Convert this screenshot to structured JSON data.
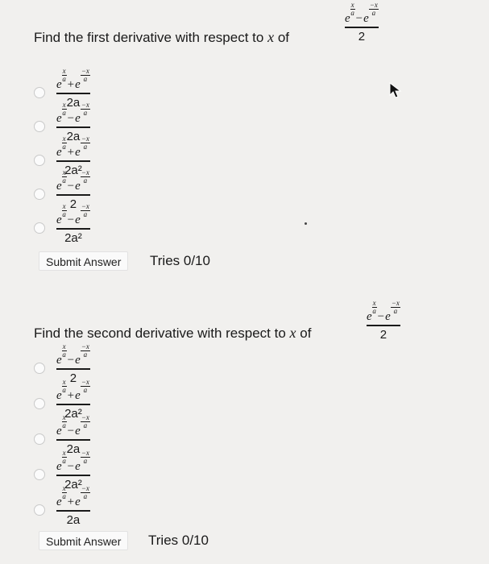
{
  "questions": [
    {
      "prompt_text": "Find the first derivative with respect to",
      "prompt_var": "x",
      "prompt_suffix": "of",
      "function": {
        "numerator": "e^(x/a) − e^(−x/a)",
        "denominator": "2"
      },
      "options": [
        {
          "op": "+",
          "denominator": "2a"
        },
        {
          "op": "−",
          "denominator": "2a"
        },
        {
          "op": "+",
          "denominator": "2a²"
        },
        {
          "op": "−",
          "denominator": "2"
        },
        {
          "op": "−",
          "denominator": "2a²"
        }
      ],
      "submit_label": "Submit Answer",
      "tries": "Tries 0/10"
    },
    {
      "prompt_text": "Find the second derivative with respect to",
      "prompt_var": "x",
      "prompt_suffix": "of",
      "function": {
        "numerator": "e^(x/a) − e^(−x/a)",
        "denominator": "2"
      },
      "options": [
        {
          "op": "−",
          "denominator": "2"
        },
        {
          "op": "+",
          "denominator": "2a²"
        },
        {
          "op": "−",
          "denominator": "2a"
        },
        {
          "op": "−",
          "denominator": "2a²"
        },
        {
          "op": "+",
          "denominator": "2a"
        }
      ],
      "submit_label": "Submit Answer",
      "tries": "Tries 0/10"
    }
  ],
  "exp": {
    "base": "e",
    "pos_num": "x",
    "neg_num": "−x",
    "den": "a"
  },
  "colors": {
    "background": "#f1f0ee",
    "radio_border": "#c9c9c9"
  },
  "icons": [
    "cursor-arrow-icon"
  ]
}
